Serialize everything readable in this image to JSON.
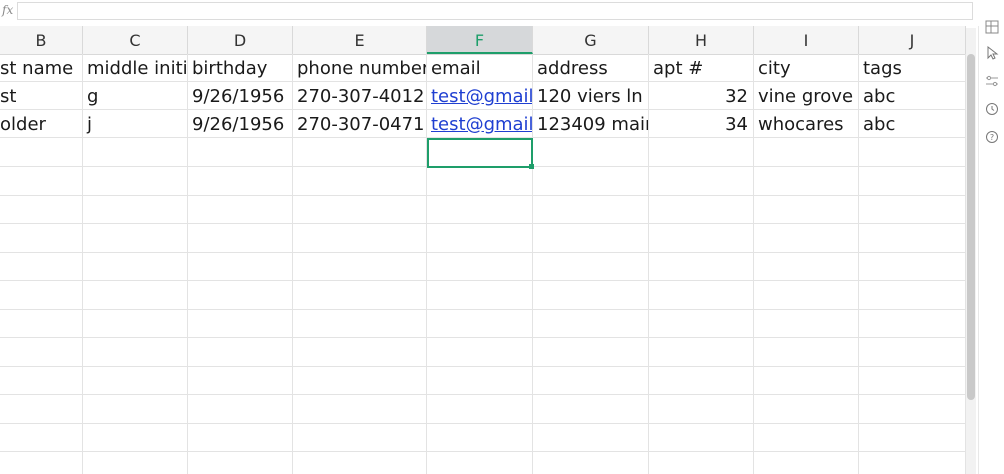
{
  "formula_bar": {
    "fx_label": "fx",
    "value": ""
  },
  "columns": [
    {
      "key": "B",
      "label": "B"
    },
    {
      "key": "C",
      "label": "C"
    },
    {
      "key": "D",
      "label": "D"
    },
    {
      "key": "E",
      "label": "E"
    },
    {
      "key": "F",
      "label": "F"
    },
    {
      "key": "G",
      "label": "G"
    },
    {
      "key": "H",
      "label": "H"
    },
    {
      "key": "I",
      "label": "I"
    },
    {
      "key": "J",
      "label": "J"
    }
  ],
  "active_column": "F",
  "rows": [
    [
      "st name",
      "middle initia",
      "birthday",
      "phone number",
      "email",
      "address",
      "apt #",
      "city",
      "tags"
    ],
    [
      "st",
      "g",
      "9/26/1956",
      "270-307-4012",
      "test@gmail",
      "120 viers ln",
      "32",
      "vine grove",
      "abc"
    ],
    [
      "older",
      "j",
      "9/26/1956",
      "270-307-0471",
      "test@gmail",
      "123409 mair",
      "34",
      "whocares",
      "abc"
    ]
  ],
  "colors": {
    "accent": "#1e9e6a",
    "link": "#1f3fd1"
  },
  "side_icons": [
    "freeze-icon",
    "cursor-icon",
    "filter-icon",
    "history-icon",
    "help-icon"
  ]
}
